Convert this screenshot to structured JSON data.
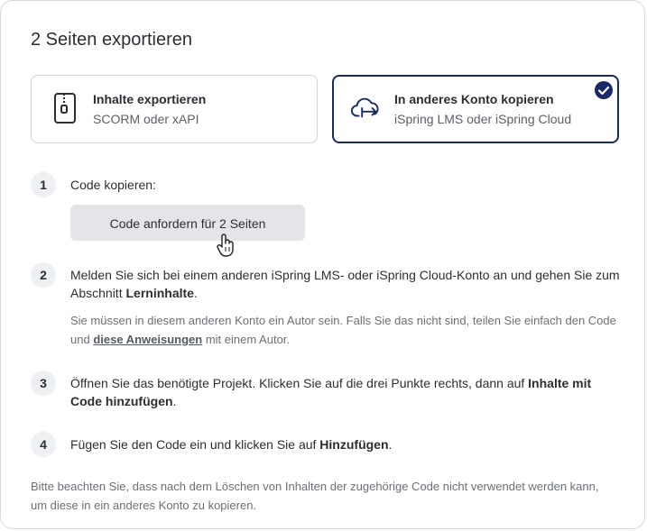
{
  "dialog": {
    "title": "2 Seiten exportieren"
  },
  "options": [
    {
      "title": "Inhalte exportieren",
      "subtitle": "SCORM oder xAPI",
      "icon": "zip-file-icon",
      "selected": false
    },
    {
      "title": "In anderes Konto kopieren",
      "subtitle": "iSpring LMS oder iSpring Cloud",
      "icon": "cloud-transfer-icon",
      "selected": true
    }
  ],
  "steps": [
    {
      "number": "1",
      "text": "Code kopieren:",
      "button_label": "Code anfordern für 2 Seiten"
    },
    {
      "number": "2",
      "text_before": "Melden Sie sich bei einem anderen iSpring LMS- oder iSpring Cloud-Konto an und gehen Sie zum Abschnitt ",
      "text_bold": "Lerninhalte",
      "text_after": ".",
      "note_before": "Sie müssen in diesem anderen Konto ein Autor sein. Falls Sie das nicht sind, teilen Sie einfach den Code und ",
      "note_link": "diese Anweisungen",
      "note_after": " mit einem Autor."
    },
    {
      "number": "3",
      "text_before": "Öffnen Sie das benötigte Projekt. Klicken Sie auf die drei Punkte rechts, dann auf ",
      "text_bold": "Inhalte mit Code hinzufügen",
      "text_after": "."
    },
    {
      "number": "4",
      "text_before": "Fügen Sie den Code ein und klicken Sie auf ",
      "text_bold": "Hinzufügen",
      "text_after": "."
    }
  ],
  "footer_note": "Bitte beachten Sie, dass nach dem Löschen von Inhalten der zugehörige Code nicht verwendet werden kann, um diese in ein anderes Konto zu kopieren.",
  "colors": {
    "selected_border": "#1b2a66",
    "check_fill": "#1b2a66",
    "button_bg": "#e3e5e8"
  }
}
